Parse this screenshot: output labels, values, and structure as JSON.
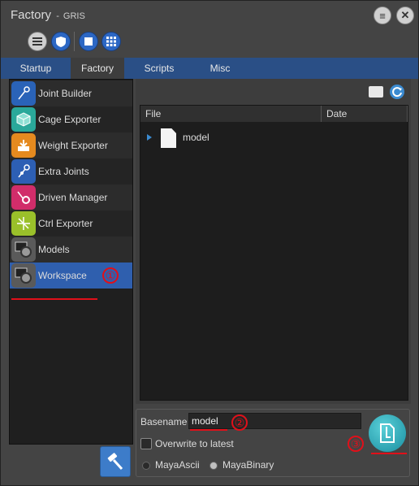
{
  "window": {
    "title": "Factory",
    "subtitle": "GRIS"
  },
  "tabs": [
    {
      "label": "Startup"
    },
    {
      "label": "Factory"
    },
    {
      "label": "Scripts"
    },
    {
      "label": "Misc"
    }
  ],
  "active_tab": "Factory",
  "sidebar": {
    "items": [
      {
        "label": "Joint Builder",
        "icon": "joint-builder-icon"
      },
      {
        "label": "Cage Exporter",
        "icon": "cage-exporter-icon"
      },
      {
        "label": "Weight Exporter",
        "icon": "weight-exporter-icon"
      },
      {
        "label": "Extra Joints",
        "icon": "extra-joints-icon"
      },
      {
        "label": "Driven Manager",
        "icon": "driven-manager-icon"
      },
      {
        "label": "Ctrl Exporter",
        "icon": "ctrl-exporter-icon"
      },
      {
        "label": "Models",
        "icon": "models-icon"
      },
      {
        "label": "Workspace",
        "icon": "workspace-icon"
      }
    ],
    "selected": "Workspace"
  },
  "file_list": {
    "columns": [
      "File",
      "Date"
    ],
    "rows": [
      {
        "name": "model",
        "date": ""
      }
    ]
  },
  "form": {
    "basename_label": "Basename",
    "basename_value": "model",
    "overwrite_label": "Overwrite to latest",
    "format_options": [
      "MayaAscii",
      "MayaBinary"
    ],
    "format_selected": "MayaBinary"
  },
  "annotations": {
    "n1": "①",
    "n2": "②",
    "n3": "③"
  },
  "colors": {
    "accent": "#2f5fae",
    "tab_bar": "#2a4f86",
    "annotation_red": "#e0101a"
  }
}
